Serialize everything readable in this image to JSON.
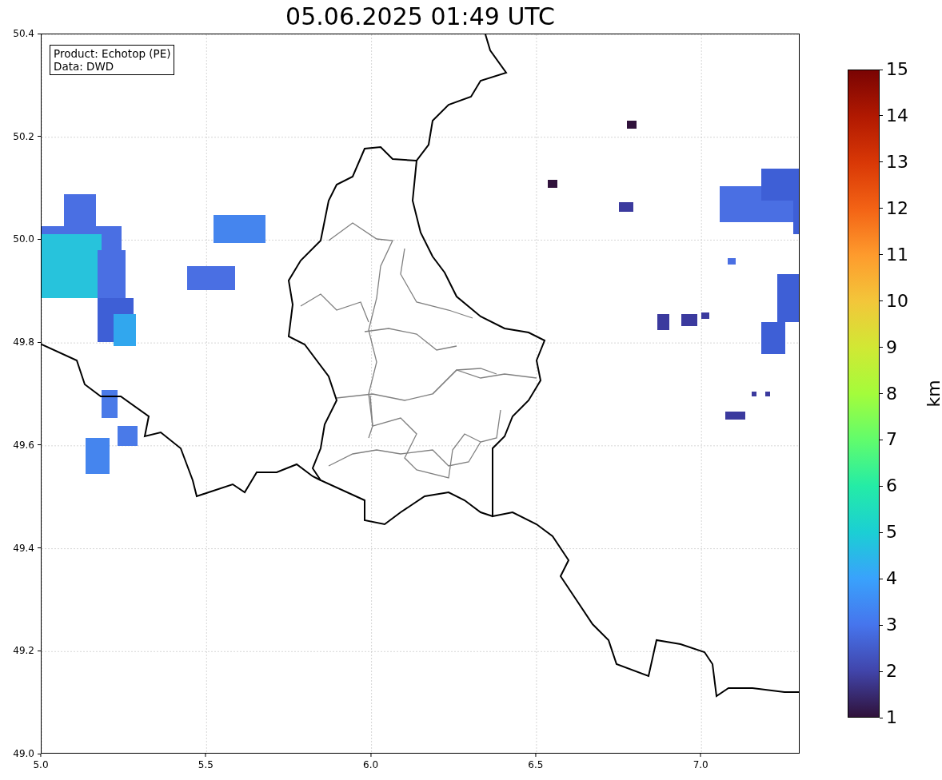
{
  "title": "05.06.2025 01:49 UTC",
  "info_box": {
    "lines": [
      "Product: Echotop (PE)",
      "Data: DWD"
    ]
  },
  "map": {
    "x_ticks": [
      "5.0",
      "5.5",
      "6.0",
      "6.5",
      "7.0"
    ],
    "y_ticks": [
      "50.4",
      "50.2",
      "50.0",
      "49.8",
      "49.6",
      "49.4",
      "49.2",
      "49.0"
    ]
  },
  "colorbar": {
    "ticks": [
      "15",
      "14",
      "13",
      "12",
      "11",
      "10",
      "9",
      "8",
      "7",
      "6",
      "5",
      "4",
      "3",
      "2",
      "1"
    ],
    "label": "km"
  }
}
